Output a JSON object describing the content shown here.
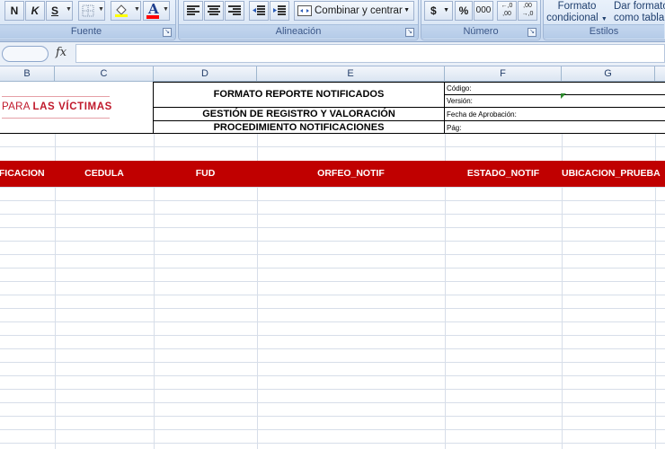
{
  "ribbon": {
    "bold": "N",
    "italic": "K",
    "underline": "S",
    "merge_center": "Combinar y centrar",
    "currency": "$",
    "percent": "%",
    "thousands": "000",
    "inc_decimal": "←,0 ,00",
    "dec_decimal": ",00 →,0",
    "conditional_format_line1": "Formato",
    "conditional_format_line2": "condicional",
    "table_format_line1": "Dar formato",
    "table_format_line2": "como tabla",
    "groups": [
      "Fuente",
      "Alineación",
      "Número",
      "Estilos"
    ],
    "fill_color": "#ffff00",
    "font_color": "#ff0000"
  },
  "formula_bar": {
    "fx": "fx",
    "value": ""
  },
  "columns": [
    "B",
    "C",
    "D",
    "E",
    "F",
    "G"
  ],
  "header": {
    "logo_prefix": "PARA ",
    "logo_bold": "LAS VÍCTIMAS",
    "title": "FORMATO REPORTE NOTIFICADOS",
    "subtitle": "GESTIÓN DE REGISTRO Y VALORACIÓN",
    "procedure": "PROCEDIMIENTO NOTIFICACIONES",
    "codigo": "Código:",
    "version": "Versión:",
    "fecha": "Fecha de Aprobación:",
    "pag": "Pág:"
  },
  "table_headers": [
    "OTIFICACION",
    "CEDULA",
    "FUD",
    "ORFEO_NOTIF",
    "ESTADO_NOTIF",
    "UBICACION_PRUEBA"
  ],
  "colors": {
    "header_red": "#c00000",
    "logo_red": "#c0192b"
  }
}
